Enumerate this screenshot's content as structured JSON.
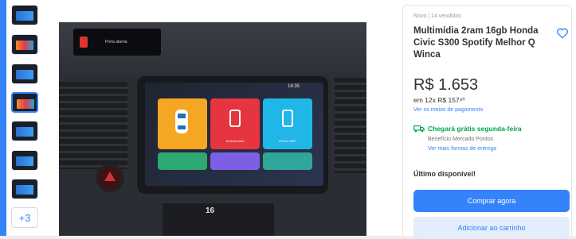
{
  "gallery": {
    "more_label": "+3",
    "thumbnails": [
      {
        "icon": "car-multimedia-thumbnail"
      },
      {
        "icon": "car-multimedia-thumbnail"
      },
      {
        "icon": "car-multimedia-thumbnail"
      },
      {
        "icon": "car-multimedia-thumbnail",
        "selected": true
      },
      {
        "icon": "car-multimedia-thumbnail"
      },
      {
        "icon": "car-multimedia-thumbnail"
      },
      {
        "icon": "car-multimedia-thumbnail"
      }
    ]
  },
  "photo": {
    "dash_display_text": "Porta aberta",
    "screen_time": "18:35",
    "tiles": [
      {
        "label": "",
        "color": "#f5a623"
      },
      {
        "label": "Android Auto",
        "color": "#e5353f"
      },
      {
        "label": "iPhone WiFi",
        "color": "#21b6e8"
      },
      {
        "label": "",
        "color": "#2ea971"
      },
      {
        "label": "",
        "color": "#7d5fe6"
      },
      {
        "label": "",
        "color": "#2fa69a"
      }
    ],
    "climate_readout": "16"
  },
  "product": {
    "condition": "Novo | 14 vendidos",
    "title": "Multimídia 2ram 16gb Honda Civic S300 Spotify Melhor Q Winca",
    "price": "R$ 1.653",
    "installments": "em 12x R$ 157⁸⁰",
    "payment_link": "Ver os meios de pagamento",
    "shipping": "Chegará grátis segunda-feira",
    "benefit": "Benefício Mercado Pontos",
    "shipping_link": "Ver mais formas de entrega",
    "stock": "Último disponível!",
    "buy_label": "Comprar agora",
    "cart_label": "Adicionar ao carrinho"
  },
  "colors": {
    "accent": "#3483fa",
    "shipping_green": "#00a650",
    "secondary_button_bg": "#e3edfb"
  }
}
